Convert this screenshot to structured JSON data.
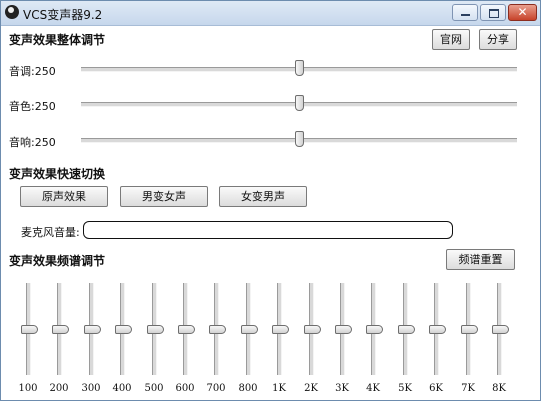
{
  "window": {
    "title": "VCS变声器9.2",
    "close_glyph": "✕",
    "icons": {
      "app": "headphones-icon",
      "minimize": "minimize-icon",
      "maximize": "maximize-icon",
      "close": "close-icon"
    }
  },
  "overall": {
    "title": "变声效果整体调节",
    "official_site_label": "官网",
    "share_label": "分享",
    "sliders": [
      {
        "label": "音调",
        "value": "250",
        "level": 0.5
      },
      {
        "label": "音色",
        "value": "250",
        "level": 0.5
      },
      {
        "label": "音响",
        "value": "250",
        "level": 0.5
      }
    ]
  },
  "quick": {
    "title": "变声效果快速切换",
    "buttons": [
      "原声效果",
      "男变女声",
      "女变男声"
    ]
  },
  "mic": {
    "label": "麦克风音量:",
    "level": 0
  },
  "eq": {
    "title": "变声效果频谱调节",
    "reset_label": "频谱重置",
    "bands": [
      {
        "label": "100",
        "level": 0.5
      },
      {
        "label": "200",
        "level": 0.5
      },
      {
        "label": "300",
        "level": 0.5
      },
      {
        "label": "400",
        "level": 0.5
      },
      {
        "label": "500",
        "level": 0.5
      },
      {
        "label": "600",
        "level": 0.5
      },
      {
        "label": "700",
        "level": 0.5
      },
      {
        "label": "800",
        "level": 0.5
      },
      {
        "label": "1K",
        "level": 0.5
      },
      {
        "label": "2K",
        "level": 0.5
      },
      {
        "label": "3K",
        "level": 0.5
      },
      {
        "label": "4K",
        "level": 0.5
      },
      {
        "label": "5K",
        "level": 0.5
      },
      {
        "label": "6K",
        "level": 0.5
      },
      {
        "label": "7K",
        "level": 0.5
      },
      {
        "label": "8K",
        "level": 0.5
      }
    ]
  }
}
